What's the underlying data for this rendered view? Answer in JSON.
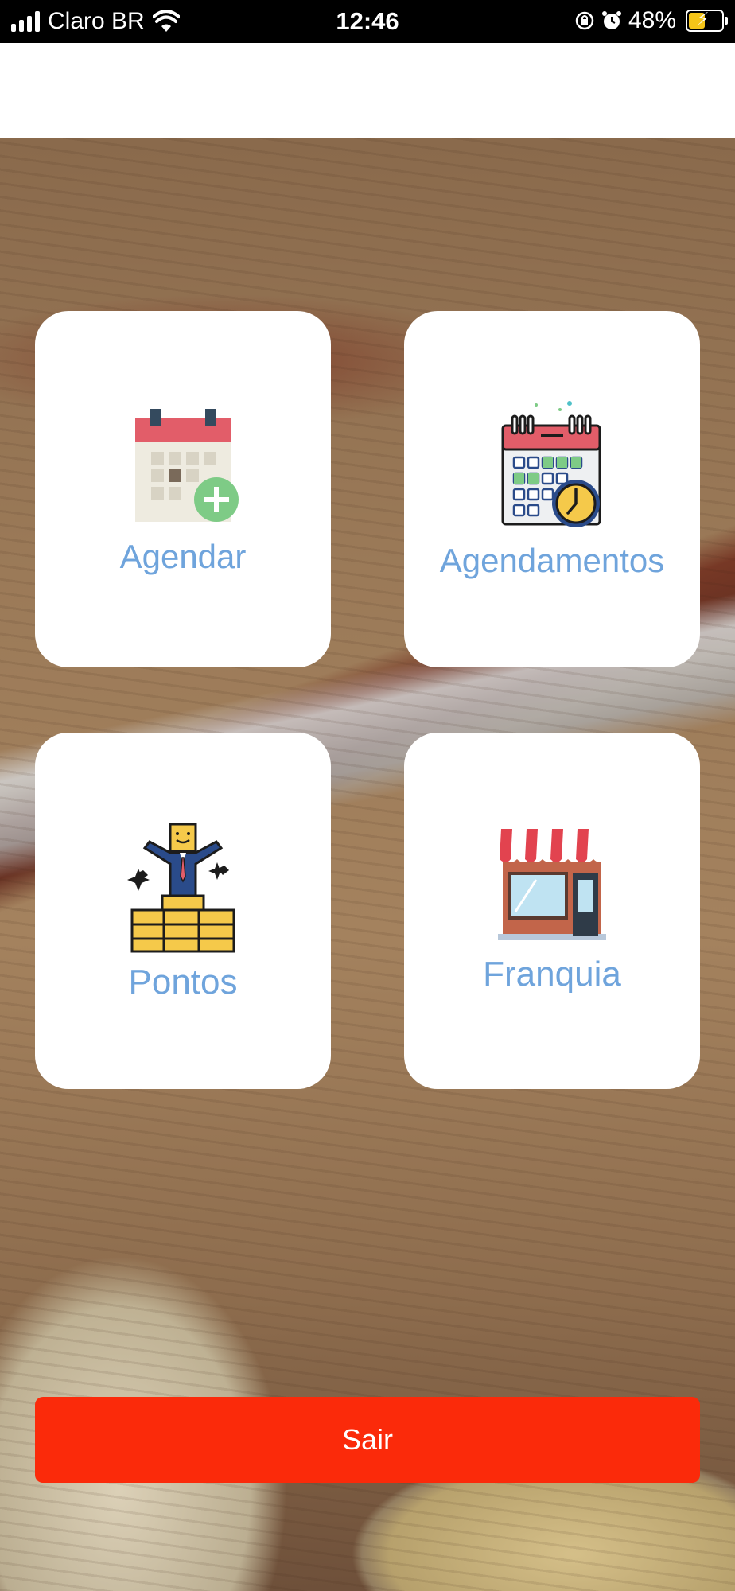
{
  "status_bar": {
    "carrier": "Claro BR",
    "time": "12:46",
    "battery_percent": "48%",
    "icons": [
      "signal-icon",
      "wifi-icon",
      "orientation-lock-icon",
      "alarm-icon",
      "battery-charging-icon"
    ]
  },
  "menu": {
    "tiles": [
      {
        "label": "Agendar",
        "icon": "calendar-add-icon"
      },
      {
        "label": "Agendamentos",
        "icon": "calendar-clock-icon"
      },
      {
        "label": "Pontos",
        "icon": "person-on-coins-icon"
      },
      {
        "label": "Franquia",
        "icon": "storefront-icon"
      }
    ]
  },
  "logout": {
    "label": "Sair",
    "color": "#fb2a0a"
  },
  "colors": {
    "tile_label": "#6fa4dc",
    "tile_bg": "#ffffff"
  }
}
